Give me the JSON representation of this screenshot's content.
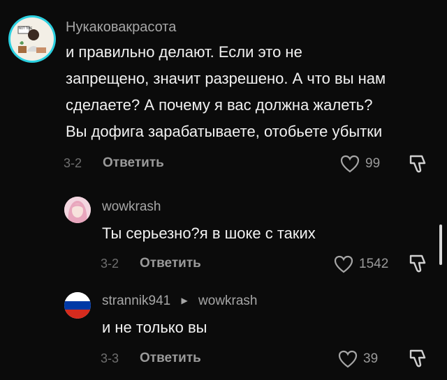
{
  "comments": [
    {
      "username": "Нукаковакрасота",
      "lines": [
        "и правильно делают. Если это не",
        "запрещено, значит разрешено. А что вы нам",
        "сделаете? А почему я вас должна жалеть?",
        "Вы дофига зарабатываете, отобьете убытки"
      ],
      "date": "3-2",
      "reply_label": "Ответить",
      "likes": "99",
      "avatar_icon": "illustrated-woman-avatar",
      "avatar_badge_text": "NOT TIME",
      "avatar_ring_color": "#2bd0e0"
    },
    {
      "username": "wowkrash",
      "text": "Ты серьезно?я в шоке с таких",
      "date": "3-2",
      "reply_label": "Ответить",
      "likes": "1542",
      "avatar_icon": "pink-hair-girl-avatar"
    },
    {
      "username": "strannik941",
      "reply_to": "wowkrash",
      "text": "и не только вы",
      "date": "3-3",
      "reply_label": "Ответить",
      "likes": "39",
      "avatar_icon": "russian-flag-avatar",
      "flag_colors": [
        "#ffffff",
        "#0039a6",
        "#d52b1e"
      ]
    }
  ],
  "icons": {
    "like": "heart-outline-icon",
    "dislike": "thumbs-down-icon",
    "reply_arrow": "triangle-right-icon"
  }
}
